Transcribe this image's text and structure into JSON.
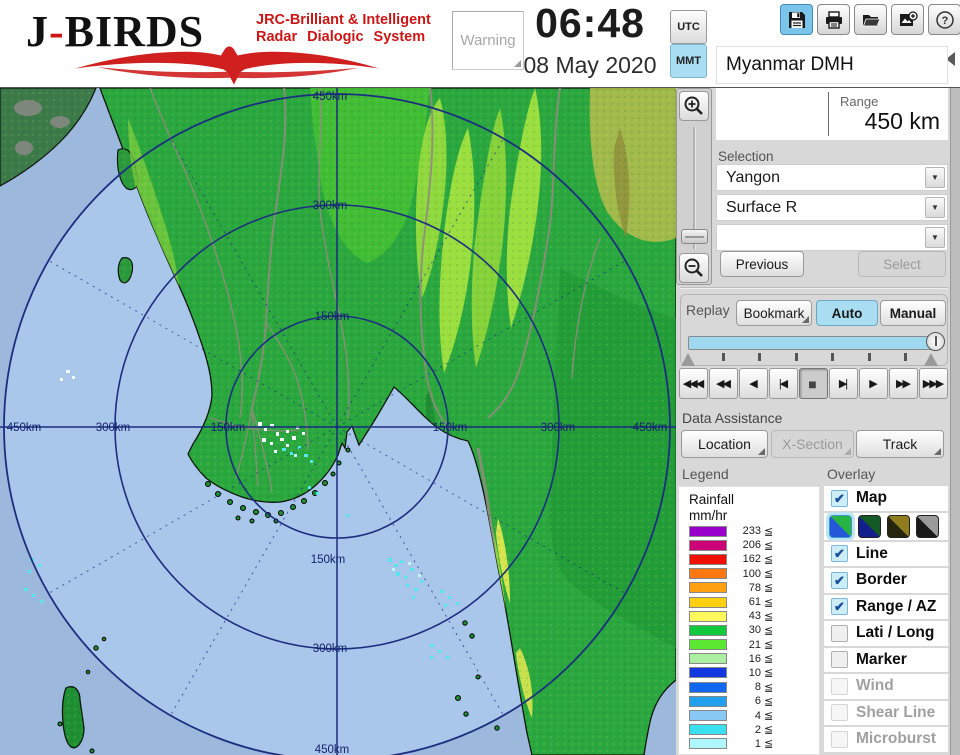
{
  "header": {
    "logo": {
      "title_left": "J",
      "hyphen": "-",
      "title_right": "BIRDS",
      "tagline1": "JRC-Brilliant & Intelligent",
      "tagline2": "Radar Dialogic System"
    },
    "warning_label": "Warning",
    "clock": {
      "time": "06:48",
      "date": "08 May 2020"
    },
    "timezone": {
      "utc": "UTC",
      "mmt": "MMT",
      "active": "MMT"
    },
    "toolbar": {
      "active": "save-button",
      "buttons": [
        "save-button",
        "print-button",
        "open-folder-button",
        "export-image-button",
        "help-button"
      ]
    }
  },
  "station_panel": {
    "station_name": "Myanmar DMH",
    "range_label": "Range",
    "range_value": "450 km",
    "selection_label": "Selection",
    "dropdowns": [
      "Yangon",
      "Surface R",
      ""
    ],
    "previous_label": "Previous",
    "select_label": "Select"
  },
  "replay": {
    "label": "Replay",
    "bookmark_label": "Bookmark",
    "auto_label": "Auto",
    "manual_label": "Manual",
    "active_mode": "Auto",
    "playback": [
      "fast-rewind-3",
      "fast-rewind-2",
      "play-backward",
      "step-first",
      "stop",
      "step-last",
      "play-forward",
      "fast-forward-2",
      "fast-forward-3"
    ],
    "active_playback": "stop"
  },
  "data_assistance": {
    "label": "Data Assistance",
    "buttons": [
      {
        "label": "Location",
        "enabled": true
      },
      {
        "label": "X-Section",
        "enabled": false
      },
      {
        "label": "Track",
        "enabled": true
      }
    ]
  },
  "legend": {
    "label": "Legend",
    "title1": "Rainfall",
    "title2": "mm/hr",
    "suffix": "≦",
    "entries": [
      {
        "value": "233",
        "color": "#9a00cc"
      },
      {
        "value": "206",
        "color": "#cc0077"
      },
      {
        "value": "162",
        "color": "#ee1100"
      },
      {
        "value": "100",
        "color": "#ff7711"
      },
      {
        "value": "78",
        "color": "#ffa011"
      },
      {
        "value": "61",
        "color": "#ffd011"
      },
      {
        "value": "43",
        "color": "#fff95e"
      },
      {
        "value": "30",
        "color": "#12c83c"
      },
      {
        "value": "21",
        "color": "#5ae832"
      },
      {
        "value": "16",
        "color": "#aaf0a0"
      },
      {
        "value": "10",
        "color": "#1238e0"
      },
      {
        "value": "8",
        "color": "#1166ee"
      },
      {
        "value": "6",
        "color": "#22a0f0"
      },
      {
        "value": "4",
        "color": "#88c8f4"
      },
      {
        "value": "2",
        "color": "#3ae0ee"
      },
      {
        "value": "1",
        "color": "#aef8fc"
      }
    ]
  },
  "overlay": {
    "label": "Overlay",
    "map_styles": [
      {
        "name": "day",
        "sea": "#2558d8",
        "land": "#27b444",
        "selected": true
      },
      {
        "name": "night",
        "sea": "#141e8c",
        "land": "#145a26",
        "selected": false
      },
      {
        "name": "olive",
        "sea": "#26260e",
        "land": "#8f7d1e",
        "selected": false
      },
      {
        "name": "mono",
        "sea": "#1a1a1a",
        "land": "#9a9a9a",
        "selected": false
      }
    ],
    "items": [
      {
        "label": "Map",
        "checked": true,
        "enabled": true,
        "swatches_after": true
      },
      {
        "label": "Line",
        "checked": true,
        "enabled": true
      },
      {
        "label": "Border",
        "checked": true,
        "enabled": true
      },
      {
        "label": "Range / AZ",
        "checked": true,
        "enabled": true
      },
      {
        "label": "Lati / Long",
        "checked": false,
        "enabled": true
      },
      {
        "label": "Marker",
        "checked": false,
        "enabled": true
      },
      {
        "label": "Wind",
        "checked": false,
        "enabled": false
      },
      {
        "label": "Shear Line",
        "checked": false,
        "enabled": false
      },
      {
        "label": "Microburst",
        "checked": false,
        "enabled": false
      }
    ]
  },
  "map": {
    "range_labels": {
      "r150": "150km",
      "r300": "300km",
      "r450": "450km"
    },
    "colors": {
      "sea_outer": "#9db8dd",
      "sea_inner": "#a9c7ea",
      "land": "#2aa73e",
      "ring": "#1b2f80"
    }
  }
}
